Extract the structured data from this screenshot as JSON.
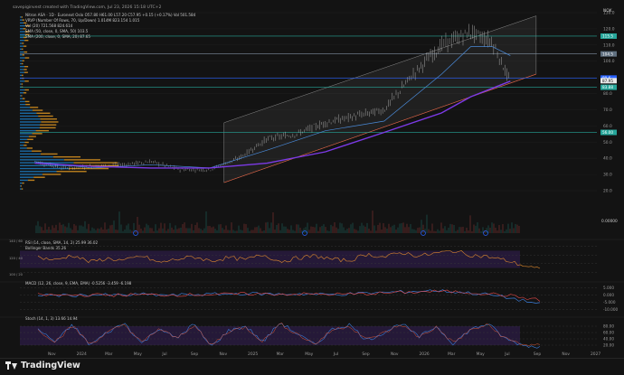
{
  "header": {
    "created_by": "savepiginvest created with TradingView.com, Jul 23, 2026 15:18 UTC+2",
    "legend_lines": [
      "Nitron ASA · 1D · Euronext Oslo  O57.80 H61.00 L57.20 C57.95 +0.15 (+0.17%)  Vol 501.584",
      "VRVP (Number Of Rows, 70, Up/Down)  1.014M  823.154  1.015",
      "Vol (20)  721.568  824.614",
      "SMA (50, close, 0, SMA, 50)  103.5",
      "SMA (200, close, 0, SMA, 20)  87.65"
    ],
    "currency": "NOK"
  },
  "colors": {
    "background": "#131313",
    "candle": "#c8c8c8",
    "sma50": "#4a8ad8",
    "sma200": "#7c3ae6",
    "channel": "#ffffff",
    "volume_profile_up": "#f5a623",
    "volume_profile_down": "#1f88d6",
    "rsi": "#e08a2e",
    "macd": "#3a7bd5",
    "signal": "#e64a4a",
    "stoch_k": "#3a7bd5",
    "stoch_d": "#e05a3a"
  },
  "chart_data": {
    "type": "candlestick",
    "title": "Nitron ASA · 1D · Euronext Oslo",
    "time_axis": [
      "Nov",
      "2024",
      "Mar",
      "May",
      "Jul",
      "Sep",
      "Nov",
      "2025",
      "Mar",
      "May",
      "Jul",
      "Sep",
      "Nov",
      "2026",
      "Mar",
      "May",
      "Jul",
      "Sep",
      "Nov",
      "2027"
    ],
    "price_axis": [
      "130.0",
      "120.0",
      "110.0",
      "100.0",
      "90.0",
      "80.0",
      "70.0",
      "60.0",
      "50.0",
      "40.0",
      "30.0",
      "20.0"
    ],
    "ylim": [
      20,
      130
    ],
    "price_path": [
      [
        "2023-11-01",
        38
      ],
      [
        "2024-01-01",
        34
      ],
      [
        "2024-03-01",
        35
      ],
      [
        "2024-05-01",
        36
      ],
      [
        "2024-07-01",
        38
      ],
      [
        "2024-09-01",
        33
      ],
      [
        "2024-11-01",
        33
      ],
      [
        "2025-01-01",
        40
      ],
      [
        "2025-03-01",
        52
      ],
      [
        "2025-05-01",
        55
      ],
      [
        "2025-07-01",
        62
      ],
      [
        "2025-09-01",
        66
      ],
      [
        "2025-11-01",
        70
      ],
      [
        "2026-01-01",
        92
      ],
      [
        "2026-03-01",
        110
      ],
      [
        "2026-05-01",
        118
      ],
      [
        "2026-06-15",
        112
      ],
      [
        "2026-07-23",
        87
      ]
    ],
    "sma50_path": [
      [
        "2023-11-01",
        38
      ],
      [
        "2024-03-01",
        34
      ],
      [
        "2024-07-01",
        36
      ],
      [
        "2024-11-01",
        34
      ],
      [
        "2025-03-01",
        45
      ],
      [
        "2025-07-01",
        57
      ],
      [
        "2025-11-01",
        63
      ],
      [
        "2026-03-01",
        92
      ],
      [
        "2026-05-01",
        109
      ],
      [
        "2026-06-15",
        109
      ],
      [
        "2026-07-23",
        103.5
      ]
    ],
    "sma200_path": [
      [
        "2023-11-01",
        37
      ],
      [
        "2024-03-01",
        35
      ],
      [
        "2024-07-01",
        34
      ],
      [
        "2024-11-01",
        34
      ],
      [
        "2025-03-01",
        37
      ],
      [
        "2025-07-01",
        44
      ],
      [
        "2025-11-01",
        56
      ],
      [
        "2026-03-01",
        68
      ],
      [
        "2026-05-01",
        78
      ],
      [
        "2026-07-23",
        87.65
      ]
    ],
    "price_labels": [
      {
        "text": "115.5",
        "value": 115.5,
        "color": "#26a69a"
      },
      {
        "text": "104.5",
        "value": 104.5,
        "color": "#607080"
      },
      {
        "text": "89.6",
        "value": 89.6,
        "color": "#2962ff"
      },
      {
        "text": "87.95",
        "value": 87.95,
        "color": "#e8e8e8"
      },
      {
        "text": "83.88",
        "value": 83.88,
        "color": "#26a69a"
      },
      {
        "text": "56.00",
        "value": 56.0,
        "color": "#26a69a"
      }
    ],
    "volume_label": "0.00000",
    "rsi": {
      "label": "RSI (14, close, SMA, 14, 2)  25.99  36.02",
      "sub": "Bollinger Bands  35.26",
      "levels": [
        80,
        60,
        40,
        20
      ],
      "axis_labels": [
        "140 / 60",
        "120 / 40",
        "100 / 20"
      ],
      "path": [
        55,
        48,
        60,
        44,
        52,
        47,
        58,
        42,
        50,
        56,
        46,
        54,
        49,
        61,
        45,
        53,
        58,
        50,
        47,
        62,
        55,
        66,
        58,
        64,
        70,
        60,
        56,
        48,
        36,
        26
      ]
    },
    "macd": {
      "label": "MACD (12, 26, close, 9, EMA, EMA)  -0.5256  -3.459  -6.198",
      "levels": [
        5,
        0,
        -5,
        -10
      ],
      "axis_labels": [
        "5.000",
        "0.000",
        "-5.000",
        "-10.000"
      ],
      "path": [
        0.2,
        -0.4,
        0.1,
        -0.3,
        0.4,
        -0.2,
        0.3,
        0.6,
        1.0,
        0.5,
        0.8,
        0.2,
        0.9,
        1.6,
        2.2,
        3.0,
        1.8,
        0.4,
        -2.5,
        -6.2
      ],
      "signal_path": [
        0.1,
        -0.2,
        0.0,
        -0.1,
        0.2,
        0.0,
        0.2,
        0.4,
        0.7,
        0.6,
        0.6,
        0.4,
        0.6,
        1.2,
        1.8,
        2.4,
        2.0,
        1.0,
        -0.8,
        -3.5
      ]
    },
    "stoch": {
      "label": "Stoch (14, 1, 3)  13.66  14.94",
      "levels": [
        80,
        60,
        40,
        20
      ],
      "axis_labels": [
        "80.00",
        "60.00",
        "40.00",
        "20.00"
      ],
      "path": [
        70,
        30,
        85,
        20,
        60,
        90,
        25,
        75,
        40,
        88,
        15,
        65,
        80,
        30,
        92,
        55,
        20,
        70,
        85,
        35,
        60,
        90,
        45,
        80,
        25,
        70,
        88,
        40,
        20,
        14
      ]
    }
  },
  "footer": {
    "brand": "TradingView"
  }
}
